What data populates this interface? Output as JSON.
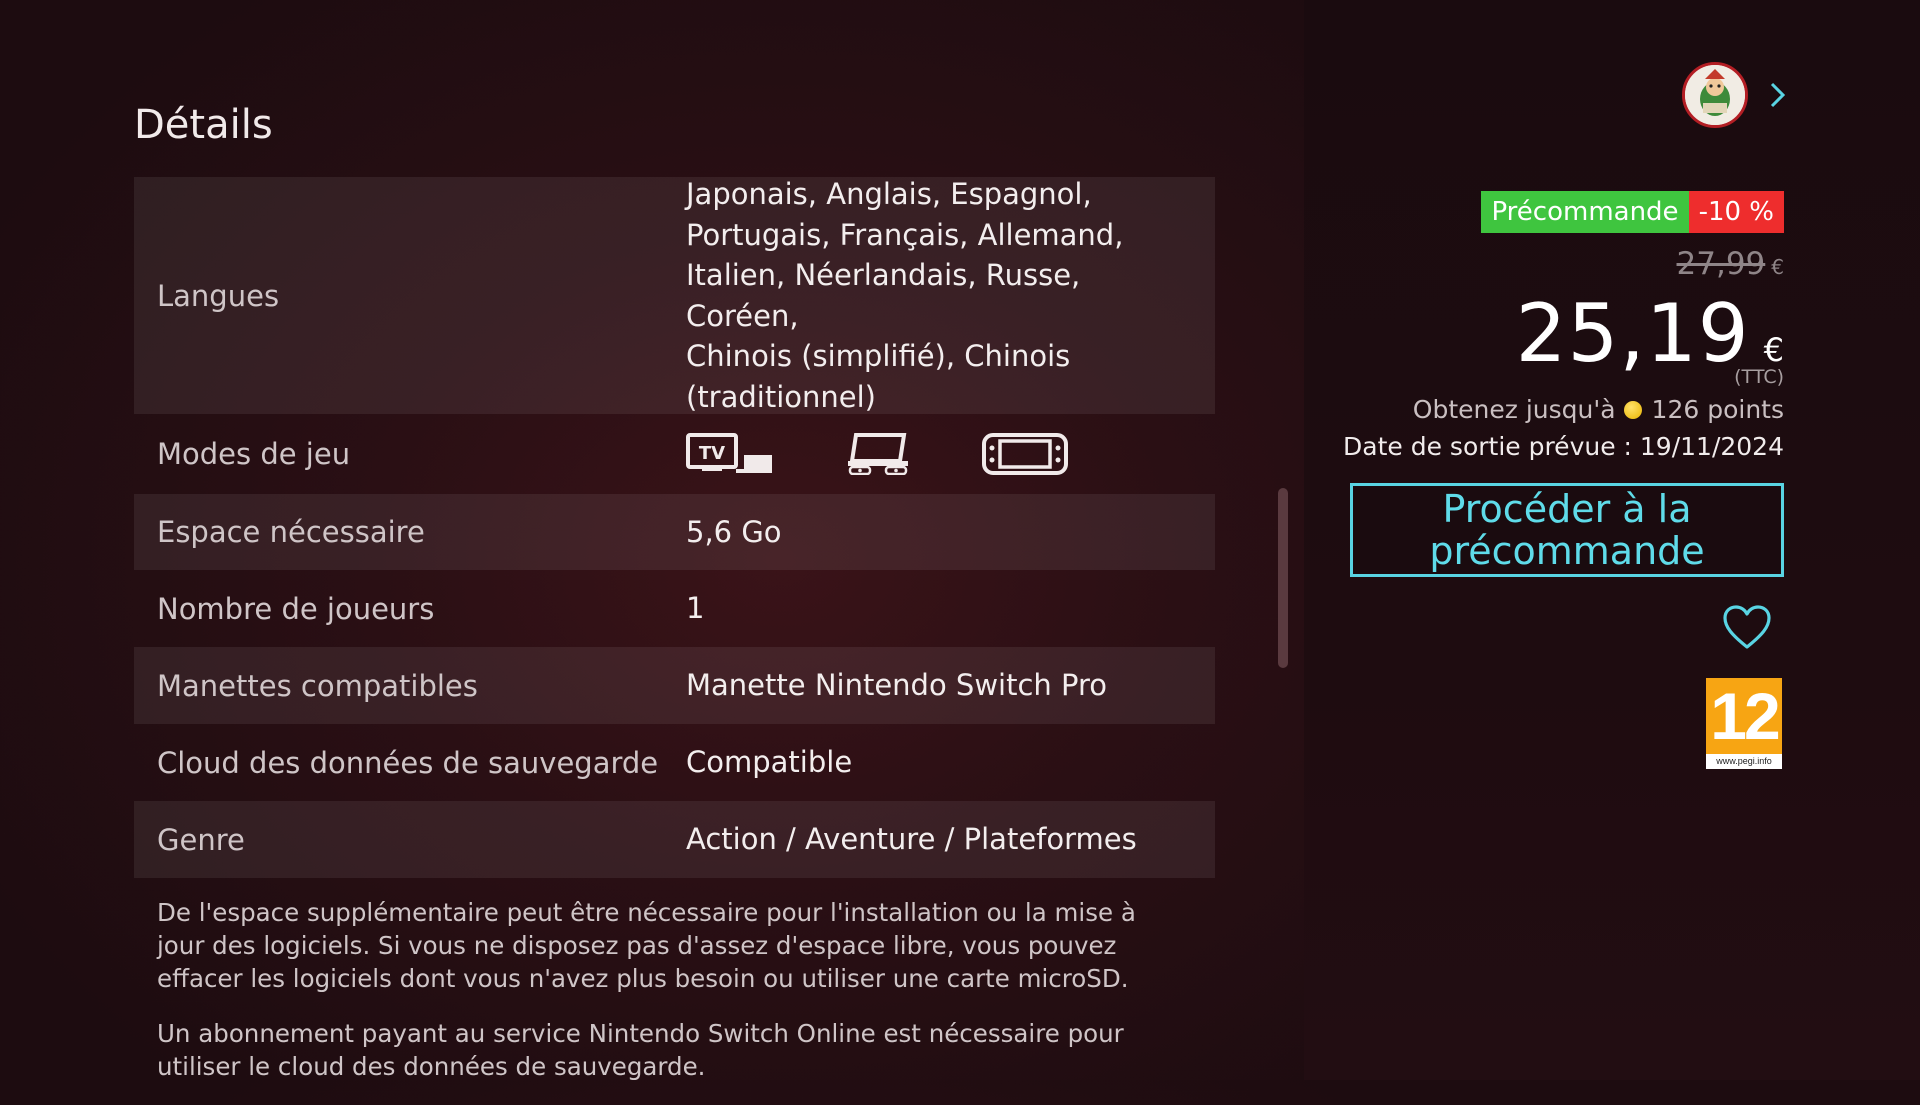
{
  "header": {
    "clipped_top_text": "",
    "section_title": "Détails"
  },
  "details": {
    "languages": {
      "label": "Langues",
      "value_lines": [
        "Japonais, Anglais, Espagnol,",
        "Portugais, Français, Allemand,",
        "Italien, Néerlandais, Russe, Coréen,",
        "Chinois (simplifié), Chinois",
        "(traditionnel)"
      ]
    },
    "play_modes": {
      "label": "Modes de jeu",
      "icons": [
        "tv-mode-icon",
        "tabletop-mode-icon",
        "handheld-mode-icon"
      ]
    },
    "storage": {
      "label": "Espace nécessaire",
      "value": "5,6 Go"
    },
    "players": {
      "label": "Nombre de joueurs",
      "value": "1"
    },
    "controllers": {
      "label": "Manettes compatibles",
      "value": "Manette Nintendo Switch Pro"
    },
    "cloud_save": {
      "label": "Cloud des données de sauvegarde",
      "value": "Compatible"
    },
    "genre": {
      "label": "Genre",
      "value": "Action / Aventure / Plateformes"
    }
  },
  "notes": [
    "De l'espace supplémentaire peut être nécessaire pour l'installation ou la mise à jour des logiciels. Si vous ne disposez pas d'assez d'espace libre, vous pouvez effacer les logiciels dont vous n'avez plus besoin ou utiliser une carte microSD.",
    "Un abonnement payant au service Nintendo Switch Online est nécessaire pour utiliser le cloud des données de sauvegarde."
  ],
  "purchase": {
    "badge_preorder": "Précommande",
    "badge_discount": "-10 %",
    "old_price": "27,99",
    "old_currency": "€",
    "price": "25,19",
    "currency": "€",
    "ttc": "(TTC)",
    "points_prefix": "Obtenez jusqu'à",
    "points_value": "126 points",
    "release": "Date de sortie prévue : 19/11/2024",
    "cta_label": "Procéder à la précommande",
    "rating": {
      "number": "12",
      "url": "www.pegi.info"
    }
  },
  "colors": {
    "accent_cyan": "#59d4e3",
    "preorder_green": "#3fc53f",
    "discount_red": "#ee2d2d",
    "pegi_orange": "#f7a513"
  }
}
